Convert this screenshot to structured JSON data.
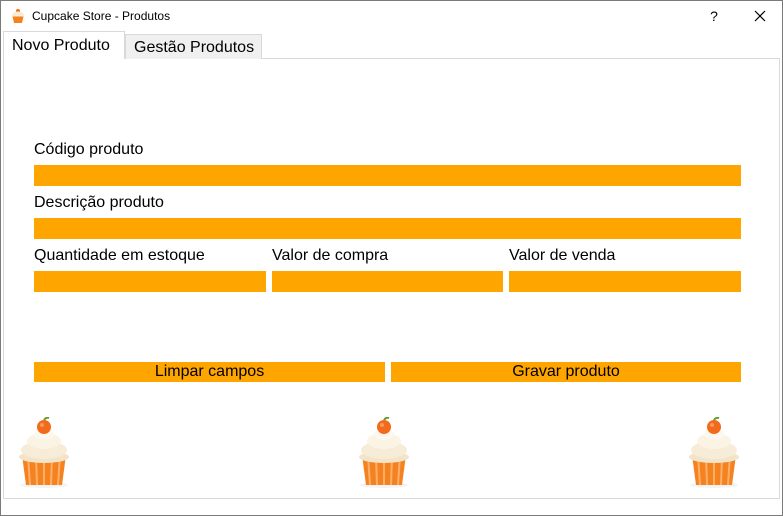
{
  "window": {
    "title": "Cupcake Store - Produtos",
    "help_label": "?",
    "icons": {
      "app": "cupcake-icon",
      "close": "close-icon"
    }
  },
  "tabs": [
    {
      "label": "Novo Produto",
      "active": true
    },
    {
      "label": "Gestão Produtos",
      "active": false
    }
  ],
  "form": {
    "codigo_label": "Código produto",
    "codigo_value": "",
    "descricao_label": "Descrição produto",
    "descricao_value": "",
    "quantidade_label": "Quantidade em estoque",
    "quantidade_value": "",
    "valor_compra_label": "Valor de compra",
    "valor_compra_value": "",
    "valor_venda_label": "Valor de venda",
    "valor_venda_value": ""
  },
  "buttons": {
    "limpar_label": "Limpar campos",
    "gravar_label": "Gravar produto"
  },
  "decorations": {
    "image": "cupcake-image"
  },
  "colors": {
    "accent": "#ffa500",
    "frosting": "#f7ecd7",
    "cup": "#f5821f",
    "cherry": "#f26b1d"
  }
}
